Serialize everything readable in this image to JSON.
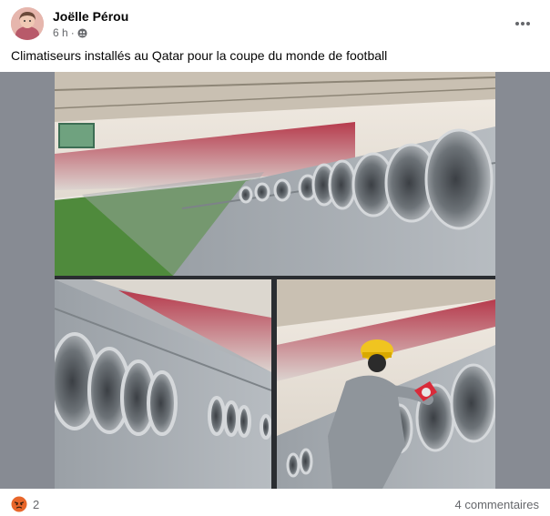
{
  "post": {
    "author": "Joëlle Pérou",
    "time": "6 h",
    "privacy_icon": "friends-icon",
    "caption": "Climatiseurs installés au Qatar pour la coupe du monde de football",
    "reaction_count": "2",
    "reaction_icon": "angry-reaction-icon",
    "comments_label": "4 commentaires",
    "more_icon": "more-options-icon"
  }
}
